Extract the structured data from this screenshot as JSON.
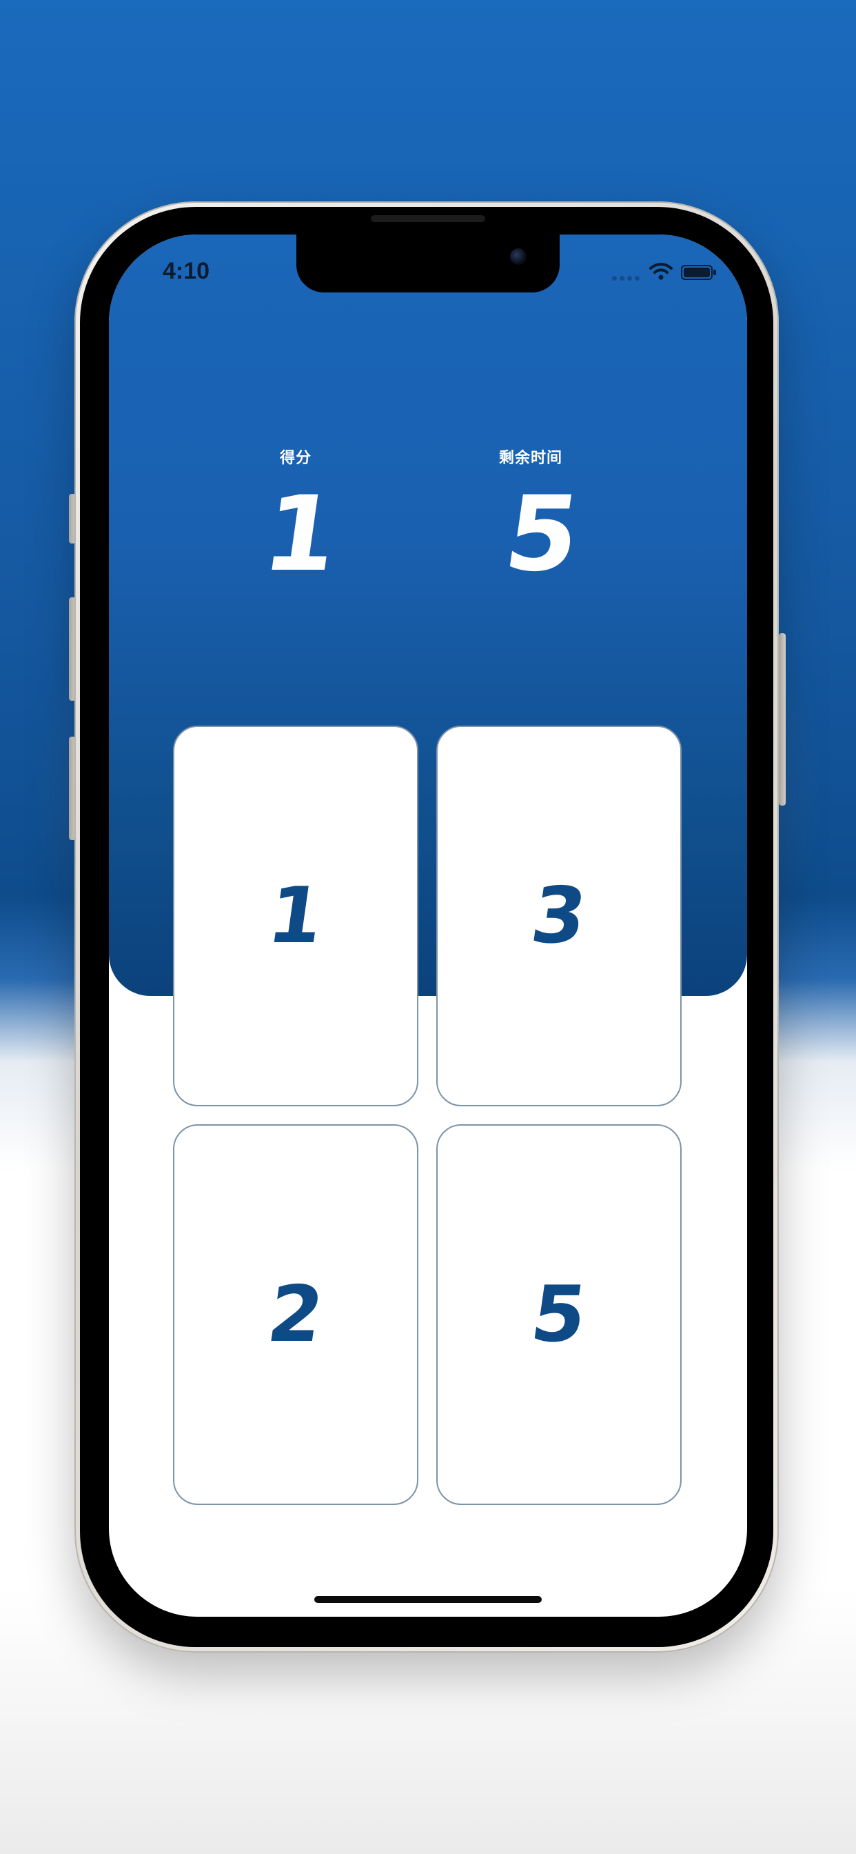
{
  "status_bar": {
    "time": "4:10"
  },
  "stats": {
    "score_label": "得分",
    "score_value": "1",
    "time_label": "剩余时间",
    "time_value": "5"
  },
  "cards": [
    {
      "value": "1"
    },
    {
      "value": "3"
    },
    {
      "value": "2"
    },
    {
      "value": "5"
    }
  ],
  "colors": {
    "header_top": "#1a66b8",
    "header_bottom": "#0b427c",
    "card_number": "#0e4a85",
    "card_border": "#7d93a8"
  },
  "icons": [
    "wifi-icon",
    "battery-icon",
    "camera-icon"
  ]
}
